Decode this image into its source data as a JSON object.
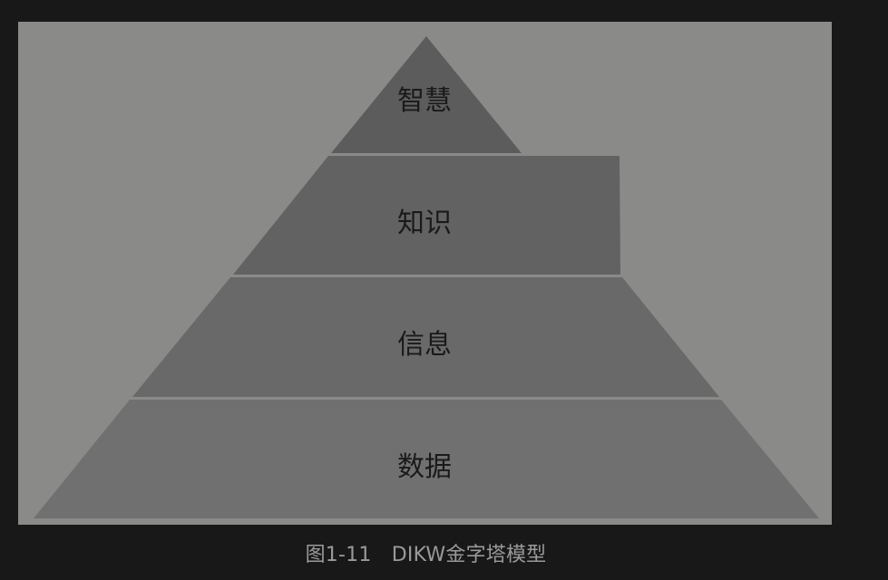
{
  "diagram": {
    "levels": [
      {
        "label": "智慧",
        "fill": "#5c5c5c"
      },
      {
        "label": "知识",
        "fill": "#626262"
      },
      {
        "label": "信息",
        "fill": "#696969"
      },
      {
        "label": "数据",
        "fill": "#707070"
      }
    ],
    "divider_color": "#8a8a88",
    "panel_color": "#8a8a88",
    "label_color": "#1a1a1a"
  },
  "caption": "图1-11　DIKW金字塔模型"
}
